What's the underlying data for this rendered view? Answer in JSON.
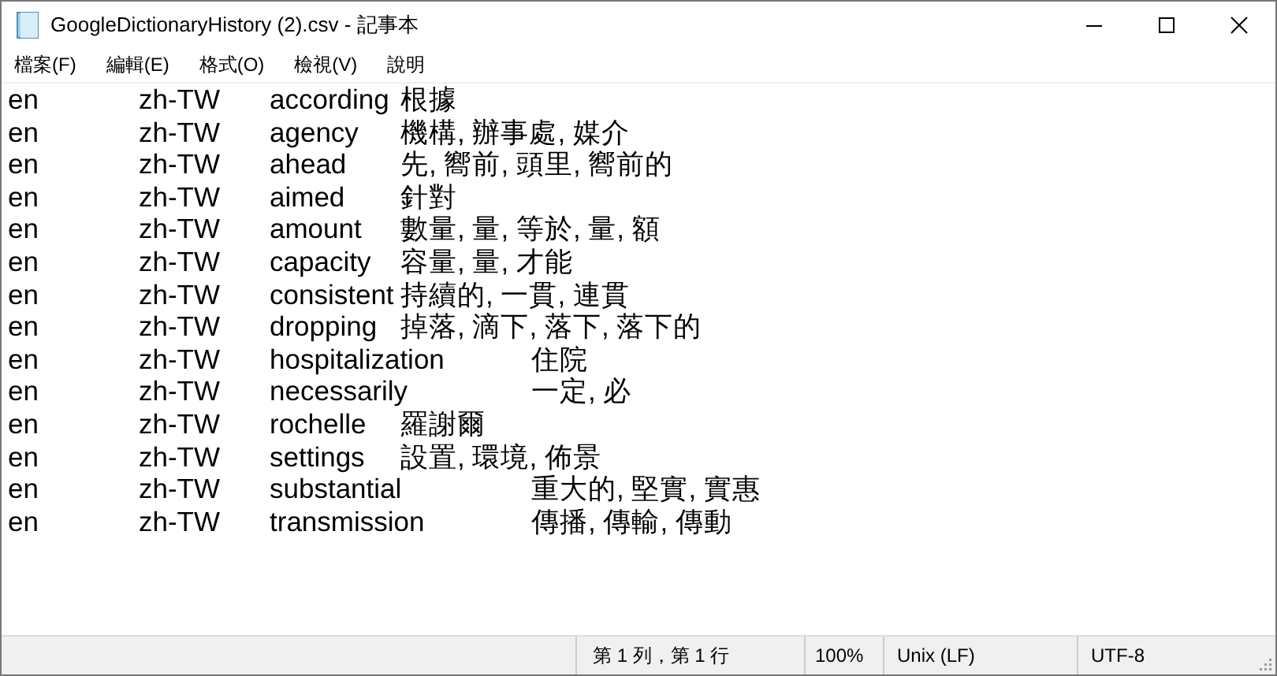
{
  "window": {
    "title": "GoogleDictionaryHistory (2).csv - 記事本"
  },
  "menu": [
    "檔案(F)",
    "編輯(E)",
    "格式(O)",
    "檢視(V)",
    "說明"
  ],
  "rows": [
    {
      "from": "en",
      "to": "zh-TW",
      "word": "according",
      "translation": "根據"
    },
    {
      "from": "en",
      "to": "zh-TW",
      "word": "agency",
      "translation": "機構, 辦事處, 媒介"
    },
    {
      "from": "en",
      "to": "zh-TW",
      "word": "ahead",
      "translation": "先, 嚮前, 頭里, 嚮前的"
    },
    {
      "from": "en",
      "to": "zh-TW",
      "word": "aimed",
      "translation": "針對"
    },
    {
      "from": "en",
      "to": "zh-TW",
      "word": "amount",
      "translation": "數量, 量, 等於, 量, 額"
    },
    {
      "from": "en",
      "to": "zh-TW",
      "word": "capacity",
      "translation": "容量, 量, 才能"
    },
    {
      "from": "en",
      "to": "zh-TW",
      "word": "consistent",
      "translation": "持續的, 一貫, 連貫"
    },
    {
      "from": "en",
      "to": "zh-TW",
      "word": "dropping",
      "translation": "掉落, 滴下, 落下, 落下的"
    },
    {
      "from": "en",
      "to": "zh-TW",
      "word": "hospitalization",
      "translation": "住院"
    },
    {
      "from": "en",
      "to": "zh-TW",
      "word": "necessarily",
      "translation": "一定, 必"
    },
    {
      "from": "en",
      "to": "zh-TW",
      "word": "rochelle",
      "translation": "羅謝爾"
    },
    {
      "from": "en",
      "to": "zh-TW",
      "word": "settings",
      "translation": "設置, 環境, 佈景"
    },
    {
      "from": "en",
      "to": "zh-TW",
      "word": "substantial",
      "translation": "重大的, 堅實, 實惠"
    },
    {
      "from": "en",
      "to": "zh-TW",
      "word": "transmission",
      "translation": "傳播, 傳輸, 傳動"
    }
  ],
  "status_bar": {
    "position": "第 1 列，第 1 行",
    "zoom": "100%",
    "line_ending": "Unix (LF)",
    "encoding": "UTF-8"
  }
}
